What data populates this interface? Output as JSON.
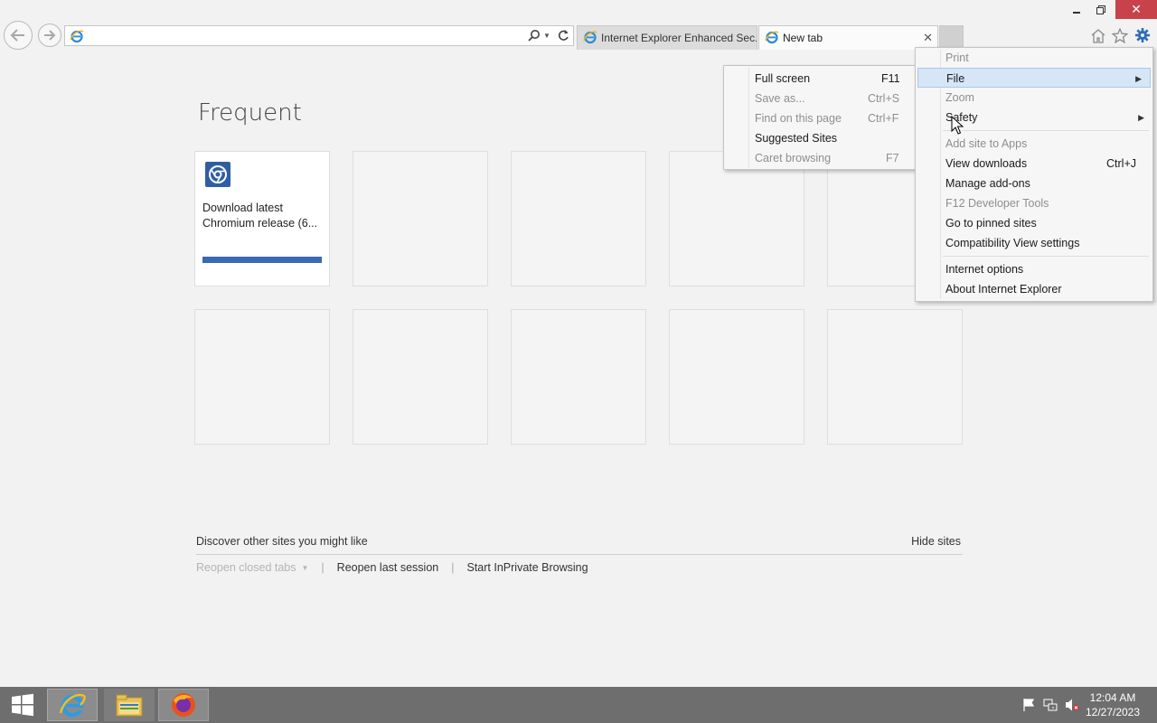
{
  "browser": {
    "address_value": "",
    "tabs": [
      {
        "label": "Internet Explorer Enhanced Sec...",
        "active": false
      },
      {
        "label": "New tab",
        "active": true
      }
    ]
  },
  "frequent": {
    "title": "Frequent",
    "tiles": [
      {
        "title": "Download latest Chromium release (6...",
        "progress": 1.0
      }
    ]
  },
  "footer": {
    "discover": "Discover other sites you might like",
    "hide_sites": "Hide sites",
    "reopen_closed_tabs": "Reopen closed tabs",
    "reopen_last_session": "Reopen last session",
    "start_inprivate": "Start InPrivate Browsing"
  },
  "tools_menu": {
    "items": [
      {
        "label": "Print",
        "key": "",
        "disabled": true
      },
      {
        "label": "File",
        "key": "",
        "submenu": true,
        "highlighted": true
      },
      {
        "label": "Zoom",
        "key": "",
        "disabled": true
      },
      {
        "label": "Safety",
        "key": "",
        "submenu": true
      },
      {
        "label": "Add site to Apps",
        "key": "",
        "disabled": true
      },
      {
        "label": "View downloads",
        "key": "Ctrl+J"
      },
      {
        "label": "Manage add-ons",
        "key": ""
      },
      {
        "label": "F12 Developer Tools",
        "key": "",
        "disabled": true
      },
      {
        "label": "Go to pinned sites",
        "key": ""
      },
      {
        "label": "Compatibility View settings",
        "key": ""
      },
      {
        "label": "Internet options",
        "key": ""
      },
      {
        "label": "About Internet Explorer",
        "key": ""
      }
    ]
  },
  "file_submenu": {
    "items": [
      {
        "label": "Full screen",
        "key": "F11"
      },
      {
        "label": "Save as...",
        "key": "Ctrl+S",
        "disabled": true
      },
      {
        "label": "Find on this page",
        "key": "Ctrl+F",
        "disabled": true
      },
      {
        "label": "Suggested Sites",
        "key": ""
      },
      {
        "label": "Caret browsing",
        "key": "F7",
        "disabled": true
      }
    ]
  },
  "taskbar": {
    "time": "12:04 AM",
    "date": "12/27/2023"
  },
  "colors": {
    "accent_blue": "#3a6ab4",
    "close_red": "#c7424a",
    "menu_highlight": "#d6e6f7"
  }
}
